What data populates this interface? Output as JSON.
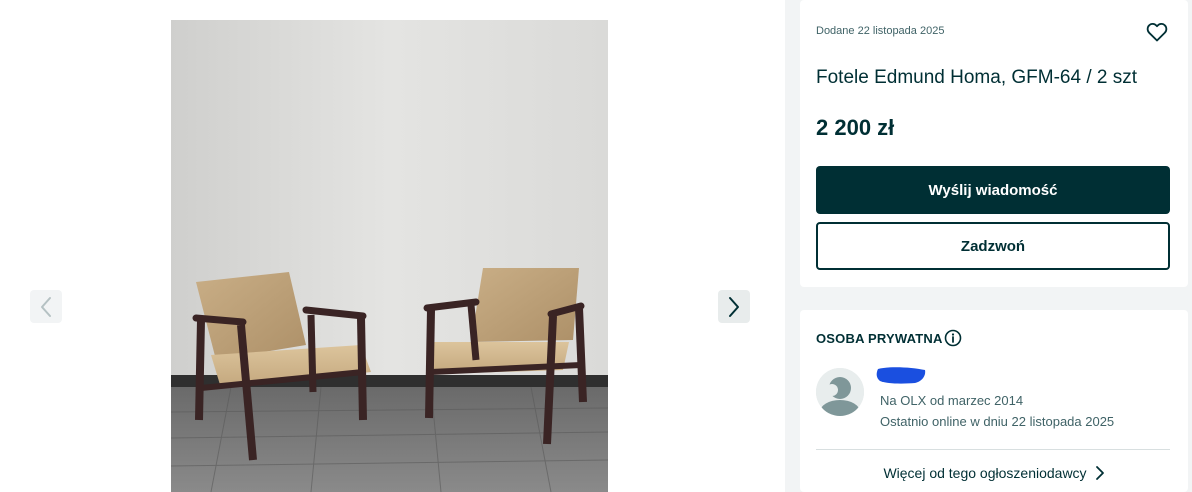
{
  "gallery": {
    "photo_alt": "",
    "prev_icon": "chevron-left-icon",
    "next_icon": "chevron-right-icon"
  },
  "listing": {
    "added": "Dodane 22 listopada 2025",
    "title": "Fotele Edmund Homa, GFM-64 / 2 szt",
    "price": "2 200 zł",
    "favorite_icon": "heart-icon",
    "message_button": "Wyślij wiadomość",
    "call_button": "Zadzwoń"
  },
  "seller": {
    "type": "OSOBA PRYWATNA",
    "info_icon": "info-icon",
    "name_redacted_color": "#1a4fe0",
    "since": "Na OLX od marzec 2014",
    "last_online": "Ostatnio online w dniu 22 listopada 2025",
    "more_link": "Więcej od tego ogłoszeniodawcy"
  },
  "colors": {
    "primary": "#002f34",
    "secondary_text": "#406367",
    "background": "#f2f4f5"
  }
}
